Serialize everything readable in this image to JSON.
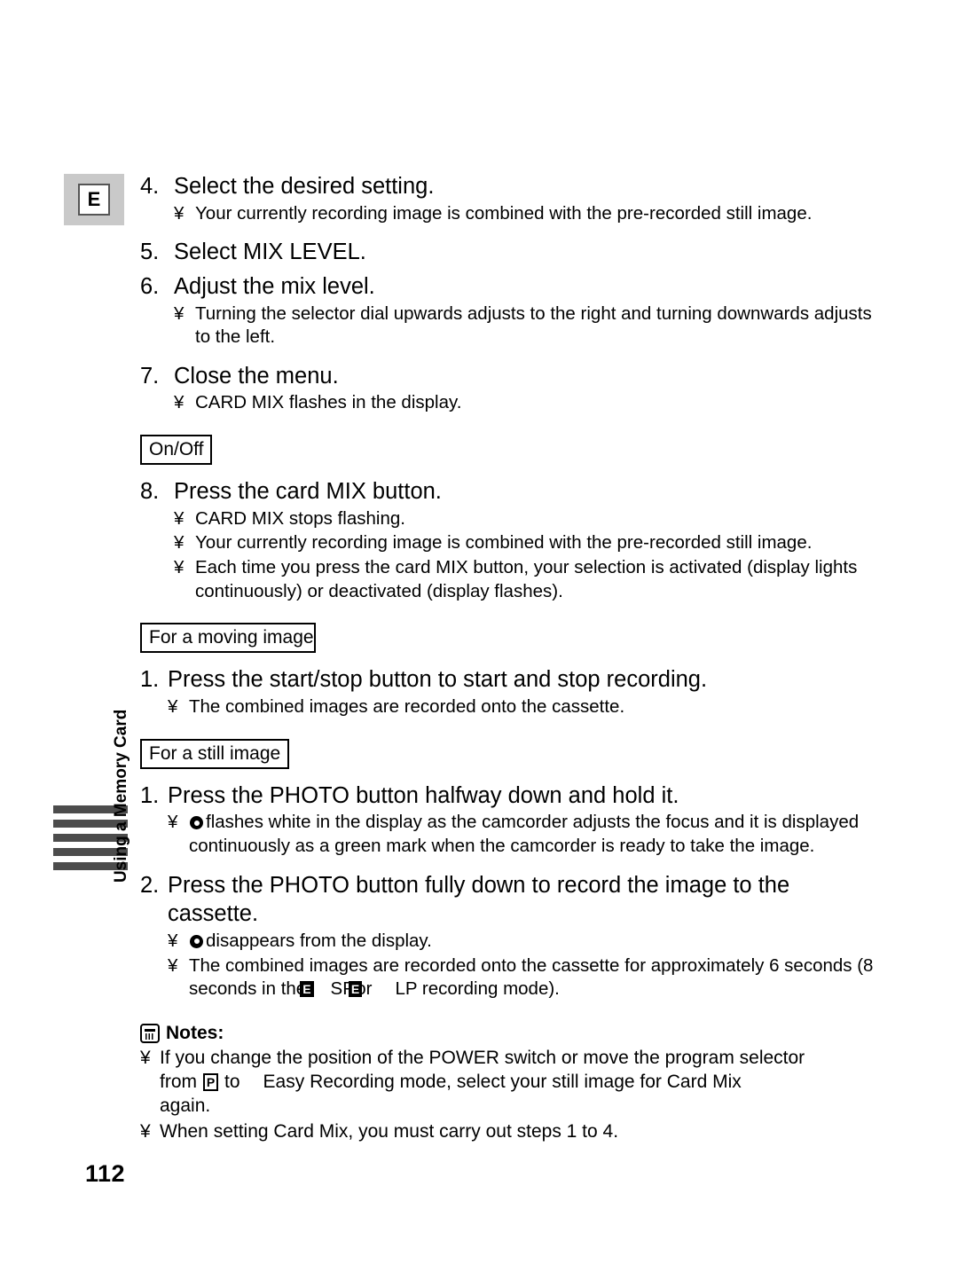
{
  "page": {
    "number": "112",
    "language_marker": "E",
    "side_tab_label": "Using a Memory Card",
    "side_tab_bar_count": 5,
    "colors": {
      "marker_background": "#c9c9c9",
      "side_tab_bar": "#4c4c4c",
      "text": "#000000",
      "page_background": "#ffffff"
    }
  },
  "bullet_glyph": "¥",
  "steps": [
    {
      "number": "4.",
      "text": "Select the desired setting.",
      "bullets": [
        "Your currently recording image is combined with the pre-recorded still image."
      ]
    },
    {
      "number": "5.",
      "text": "Select MIX LEVEL.",
      "bullets": []
    },
    {
      "number": "6.",
      "text": "Adjust the mix level.",
      "bullets": [
        "Turning the selector dial upwards adjusts to the right and turning downwards adjusts to the left."
      ]
    },
    {
      "number": "7.",
      "text": "Close the menu.",
      "bullets": [
        "CARD MIX flashes in the display."
      ]
    }
  ],
  "onoff_section": {
    "box_label": "On/Off",
    "step": {
      "number": "8.",
      "text": "Press the card MIX button.",
      "bullets": [
        "CARD MIX stops flashing.",
        "Your currently recording image is combined with the pre-recorded still image.",
        "Each time you press the card MIX button, your selection is activated (display lights continuously) or deactivated (display flashes)."
      ]
    }
  },
  "moving_image_section": {
    "box_label": "For a moving image",
    "step": {
      "number": "1.",
      "text": "Press the start/stop button to start and stop recording.",
      "bullets": [
        "The combined images are recorded onto the cassette."
      ]
    }
  },
  "still_image_section": {
    "box_label": "For a still image",
    "steps": [
      {
        "number": "1.",
        "text": "Press the PHOTO button halfway down and hold it.",
        "bullet_lead_symbol": "focus-ring-icon",
        "bullet_text": "flashes white in the display as the camcorder adjusts the focus and it is displayed continuously as a green mark when the camcorder is ready to take the image."
      },
      {
        "number": "2.",
        "text": "Press the PHOTO button fully down to record the image to the cassette.",
        "bullet_symbol_text": "disappears from the display.",
        "bullet_duration_prefix": "The combined images are recorded onto the cassette for approximately 6 seconds (8 seconds in the",
        "mode_symbol_1": "E",
        "mode_1": "SP",
        "mode_joiner": "or",
        "mode_symbol_2": "E",
        "mode_2": "LP",
        "bullet_duration_suffix": "recording mode)."
      }
    ]
  },
  "notes": {
    "heading": "Notes:",
    "icon": "notes-icon",
    "items": [
      {
        "line1": "If you change the position of the POWER switch or move the program selector",
        "line2_prefix": "from",
        "program_symbol": "P",
        "line2_mid": "to",
        "line2_suffix": "Easy Recording mode, select your still image for Card Mix",
        "line3": "again."
      },
      {
        "line1": "When setting Card Mix, you must carry out steps 1 to 4."
      }
    ]
  }
}
